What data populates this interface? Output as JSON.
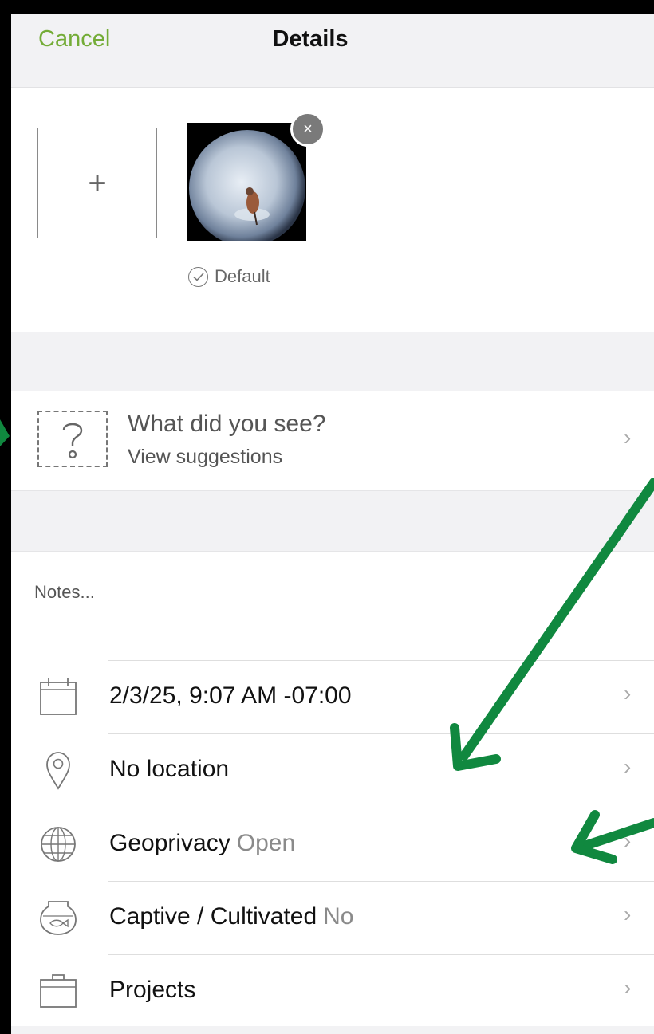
{
  "nav": {
    "cancel": "Cancel",
    "title": "Details"
  },
  "photos": {
    "default_label": "Default",
    "add_icon": "plus-icon",
    "remove_icon": "close-icon"
  },
  "species": {
    "title": "What did you see?",
    "subtitle": "View suggestions",
    "icon": "question-mark-icon"
  },
  "notes": {
    "placeholder": "Notes..."
  },
  "rows": [
    {
      "icon": "calendar-icon",
      "label": "2/3/25, 9:07 AM -07:00",
      "value": ""
    },
    {
      "icon": "location-pin-icon",
      "label": "No location",
      "value": ""
    },
    {
      "icon": "globe-icon",
      "label": "Geoprivacy",
      "value": "Open"
    },
    {
      "icon": "fishbowl-icon",
      "label": "Captive / Cultivated",
      "value": "No"
    },
    {
      "icon": "briefcase-icon",
      "label": "Projects",
      "value": ""
    }
  ],
  "colors": {
    "accent": "#74ac37",
    "annotation_arrow": "#10883f",
    "grouped_bg": "#f2f2f4"
  }
}
